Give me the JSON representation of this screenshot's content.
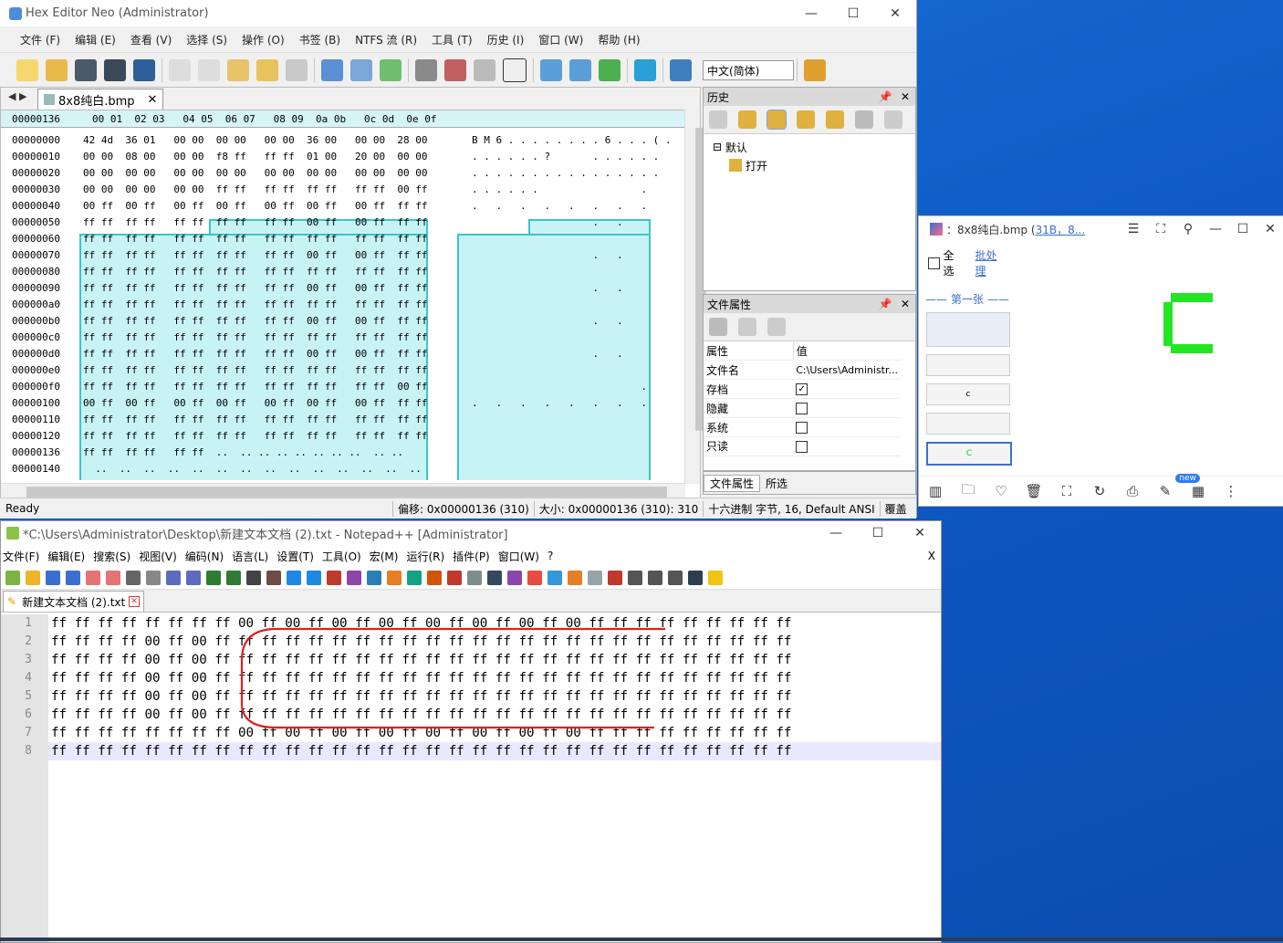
{
  "hex_editor": {
    "title": "Hex Editor Neo (Administrator)",
    "menu": [
      "文件 (F)",
      "编辑 (E)",
      "查看 (V)",
      "选择 (S)",
      "操作 (O)",
      "书签 (B)",
      "NTFS 流 (R)",
      "工具 (T)",
      "历史 (I)",
      "窗口 (W)",
      "帮助 (H)"
    ],
    "language": "中文(简体)",
    "tab_name": "8x8纯白.bmp",
    "header_offset": "00000136",
    "header_cols": "00 01  02 03   04 05  06 07   08 09  0a 0b   0c 0d  0e 0f",
    "rows": [
      {
        "off": "00000000",
        "bytes": "42 4d  36 01   00 00  00 00   00 00  36 00   00 00  28 00",
        "ascii": "B M 6 . . . . . . . . 6 . . . ( ."
      },
      {
        "off": "00000010",
        "bytes": "00 00  08 00   00 00  f8 ff   ff ff  01 00   20 00  00 00",
        "ascii": ". . . . . . ?       . . . . . ."
      },
      {
        "off": "00000020",
        "bytes": "00 00  00 00   00 00  00 00   00 00  00 00   00 00  00 00",
        "ascii": ". . . . . . . . . . . . . . . ."
      },
      {
        "off": "00000030",
        "bytes": "00 00  00 00   00 00  ff ff   ff ff  ff ff   ff ff  00 ff",
        "ascii": ". . . . . .                 ."
      },
      {
        "off": "00000040",
        "bytes": "00 ff  00 ff   00 ff  00 ff   00 ff  00 ff   00 ff  ff ff",
        "ascii": ".   .   .   .   .   .   .   ."
      },
      {
        "off": "00000050",
        "bytes": "ff ff  ff ff   ff ff  ff ff   ff ff  00 ff   00 ff  ff ff",
        "ascii": "                    .   ."
      },
      {
        "off": "00000060",
        "bytes": "ff ff  ff ff   ff ff  ff ff   ff ff  ff ff   ff ff  ff ff",
        "ascii": ""
      },
      {
        "off": "00000070",
        "bytes": "ff ff  ff ff   ff ff  ff ff   ff ff  00 ff   00 ff  ff ff",
        "ascii": "                    .   ."
      },
      {
        "off": "00000080",
        "bytes": "ff ff  ff ff   ff ff  ff ff   ff ff  ff ff   ff ff  ff ff",
        "ascii": ""
      },
      {
        "off": "00000090",
        "bytes": "ff ff  ff ff   ff ff  ff ff   ff ff  00 ff   00 ff  ff ff",
        "ascii": "                    .   ."
      },
      {
        "off": "000000a0",
        "bytes": "ff ff  ff ff   ff ff  ff ff   ff ff  ff ff   ff ff  ff ff",
        "ascii": ""
      },
      {
        "off": "000000b0",
        "bytes": "ff ff  ff ff   ff ff  ff ff   ff ff  00 ff   00 ff  ff ff",
        "ascii": "                    .   ."
      },
      {
        "off": "000000c0",
        "bytes": "ff ff  ff ff   ff ff  ff ff   ff ff  ff ff   ff ff  ff ff",
        "ascii": ""
      },
      {
        "off": "000000d0",
        "bytes": "ff ff  ff ff   ff ff  ff ff   ff ff  00 ff   00 ff  ff ff",
        "ascii": "                    .   ."
      },
      {
        "off": "000000e0",
        "bytes": "ff ff  ff ff   ff ff  ff ff   ff ff  ff ff   ff ff  ff ff",
        "ascii": ""
      },
      {
        "off": "000000f0",
        "bytes": "ff ff  ff ff   ff ff  ff ff   ff ff  ff ff   ff ff  00 ff",
        "ascii": "                            ."
      },
      {
        "off": "00000100",
        "bytes": "00 ff  00 ff   00 ff  00 ff   00 ff  00 ff   00 ff  ff ff",
        "ascii": ".   .   .   .   .   .   .   ."
      },
      {
        "off": "00000110",
        "bytes": "ff ff  ff ff   ff ff  ff ff   ff ff  ff ff   ff ff  ff ff",
        "ascii": ""
      },
      {
        "off": "00000120",
        "bytes": "ff ff  ff ff   ff ff  ff ff   ff ff  ff ff   ff ff  ff ff",
        "ascii": ""
      },
      {
        "off": "00000136",
        "bytes": "ff ff  ff ff   ff ff  ..  .. .. .. .. .. .. ..  .. ..",
        "ascii": ""
      },
      {
        "off": "00000140",
        "bytes": "  ..  ..  ..  ..  ..  ..  ..  ..  ..  ..  ..  ..  ..  ..",
        "ascii": ""
      }
    ],
    "status": {
      "ready": "Ready",
      "offset": "偏移: 0x00000136 (310)",
      "size": "大小: 0x00000136 (310): 310",
      "mode": "十六进制 字节, 16, Default ANSI",
      "overwrite": "覆盖"
    },
    "history_panel": {
      "title": "历史",
      "root": "默认",
      "item": "打开"
    },
    "props_panel": {
      "title": "文件属性",
      "col_name": "属性",
      "col_value": "值",
      "rows": [
        {
          "name": "文件名",
          "value": "C:\\Users\\Administr..."
        },
        {
          "name": "存档",
          "checked": true
        },
        {
          "name": "隐藏",
          "checked": false
        },
        {
          "name": "系统",
          "checked": false
        },
        {
          "name": "只读",
          "checked": false
        }
      ],
      "tab1": "文件属性",
      "tab2": "所选"
    }
  },
  "viewer": {
    "title_prefix": "：8x8纯白.bmp (",
    "title_link": "31B，8...",
    "select_all": "全选",
    "batch": "批处理",
    "group": "第一张",
    "thumb_selected": "C",
    "thumb_2": "c",
    "new_badge": "new",
    "accent": "#3a6fcf",
    "image_color": "#22e622"
  },
  "notepad": {
    "title": "*C:\\Users\\Administrator\\Desktop\\新建文本文档 (2).txt - Notepad++ [Administrator]",
    "menu": [
      "文件(F)",
      "编辑(E)",
      "搜索(S)",
      "视图(V)",
      "编码(N)",
      "语言(L)",
      "设置(T)",
      "工具(O)",
      "宏(M)",
      "运行(R)",
      "插件(P)",
      "窗口(W)",
      "?"
    ],
    "close_x": "X",
    "tab_name": "新建文本文档 (2).txt",
    "line_numbers": [
      "1",
      "2",
      "3",
      "4",
      "5",
      "6",
      "7",
      "8"
    ],
    "lines": [
      "ff ff ff ff ff ff ff ff 00 ff 00 ff 00 ff 00 ff 00 ff 00 ff 00 ff 00 ff ff ff ff ff ff ff ff ff",
      "ff ff ff ff 00 ff 00 ff ff ff ff ff ff ff ff ff ff ff ff ff ff ff ff ff ff ff ff ff ff ff ff ff",
      "ff ff ff ff 00 ff 00 ff ff ff ff ff ff ff ff ff ff ff ff ff ff ff ff ff ff ff ff ff ff ff ff ff",
      "ff ff ff ff 00 ff 00 ff ff ff ff ff ff ff ff ff ff ff ff ff ff ff ff ff ff ff ff ff ff ff ff ff",
      "ff ff ff ff 00 ff 00 ff ff ff ff ff ff ff ff ff ff ff ff ff ff ff ff ff ff ff ff ff ff ff ff ff",
      "ff ff ff ff 00 ff 00 ff ff ff ff ff ff ff ff ff ff ff ff ff ff ff ff ff ff ff ff ff ff ff ff ff",
      "ff ff ff ff ff ff ff ff 00 ff 00 ff 00 ff 00 ff 00 ff 00 ff 00 ff 00 ff ff ff ff ff ff ff ff ff",
      "ff ff ff ff ff ff ff ff ff ff ff ff ff ff ff ff ff ff ff ff ff ff ff ff ff ff ff ff ff ff ff ff"
    ]
  }
}
